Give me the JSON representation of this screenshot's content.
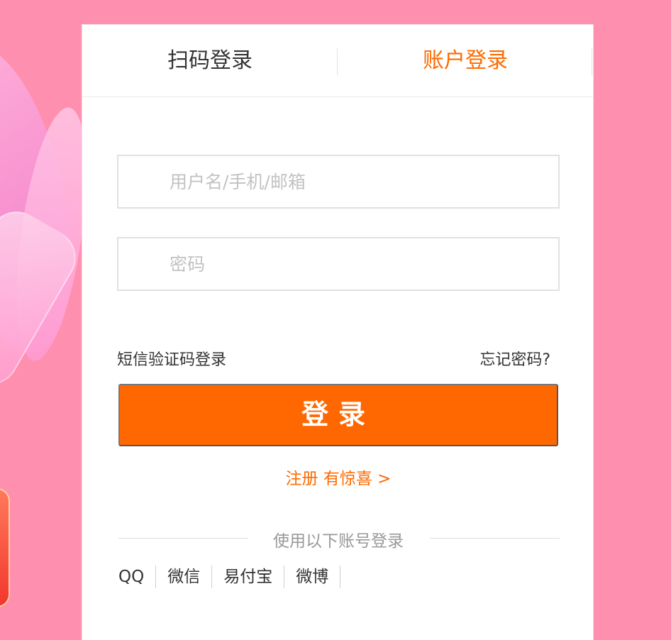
{
  "tabs": [
    {
      "label": "扫码登录",
      "active": false
    },
    {
      "label": "账户登录",
      "active": true
    }
  ],
  "form": {
    "username_placeholder": "用户名/手机/邮箱",
    "username_value": "",
    "password_placeholder": "密码",
    "password_value": ""
  },
  "links": {
    "sms_login": "短信验证码登录",
    "forgot_password": "忘记密码?",
    "register": "注册 有惊喜 >"
  },
  "login_button": "登录",
  "other_login": {
    "title": "使用以下账号登录",
    "providers": [
      "QQ",
      "微信",
      "易付宝",
      "微博"
    ]
  },
  "colors": {
    "accent": "#ff6700",
    "background": "#ff8fae"
  }
}
